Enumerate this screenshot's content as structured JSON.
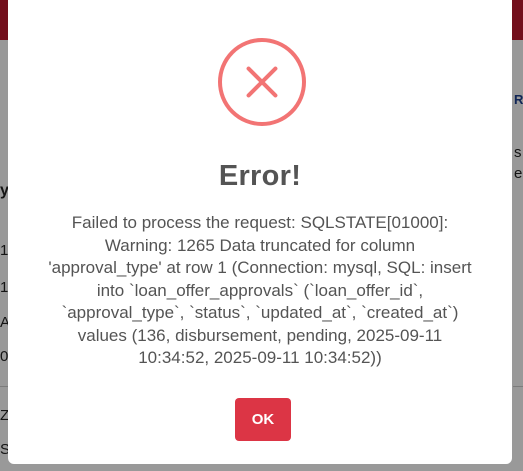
{
  "background": {
    "topbar_color": "#c0192f",
    "left_fragments": [
      "y",
      "1",
      "1",
      "A",
      "0",
      "Z",
      "S"
    ],
    "right_fragments": [
      "R",
      "s",
      "e"
    ]
  },
  "modal": {
    "icon": "error-x-icon",
    "icon_color": "#f27474",
    "title": "Error!",
    "message": "Failed to process the request: SQLSTATE[01000]: Warning: 1265 Data truncated for column 'approval_type' at row 1 (Connection: mysql, SQL: insert into `loan_offer_approvals` (`loan_offer_id`, `approval_type`, `status`, `updated_at`, `created_at`) values (136, disbursement, pending, 2025-09-11 10:34:52, 2025-09-11 10:34:52))",
    "ok_label": "OK",
    "ok_color": "#dc3545"
  }
}
